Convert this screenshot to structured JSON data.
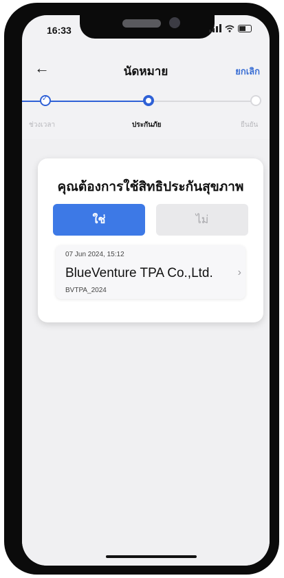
{
  "status_bar": {
    "time": "16:33"
  },
  "nav": {
    "back_icon": "←",
    "title": "นัดหมาย",
    "cancel_label": "ยกเลิก"
  },
  "stepper": {
    "steps": [
      {
        "label": "ช่วงเวลา",
        "state": "done"
      },
      {
        "label": "ประกันภัย",
        "state": "active"
      },
      {
        "label": "ยืนยัน",
        "state": "todo"
      }
    ],
    "done_icon": "✓"
  },
  "card": {
    "question": "คุณต้องการใช้สิทธิประกันสุขภาพ",
    "yes_label": "ใช่",
    "no_label": "ไม่",
    "policy": {
      "date": "07 Jun 2024, 15:12",
      "name": "BlueVenture TPA Co.,Ltd.",
      "code": "BVTPA_2024",
      "chevron": "›"
    }
  },
  "colors": {
    "accent": "#3d79e6",
    "step": "#2f61d6",
    "link": "#3b6fd4"
  }
}
